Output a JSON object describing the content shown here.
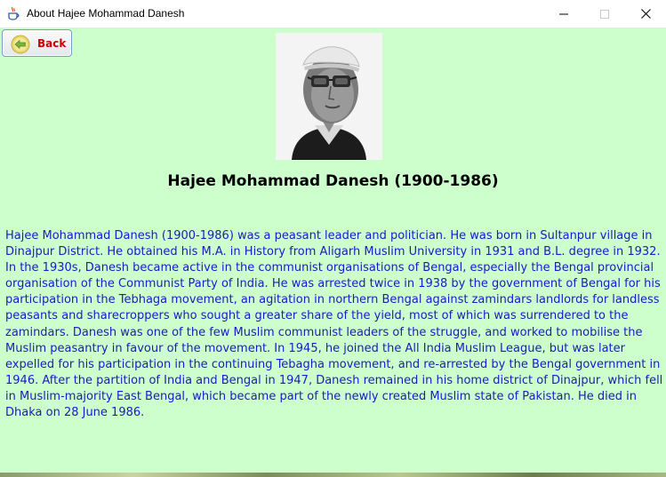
{
  "window": {
    "title": "About Hajee Mohammad Danesh",
    "controls": {
      "minimize_icon": "minimize-icon",
      "maximize_icon": "maximize-icon",
      "close_icon": "close-icon"
    }
  },
  "toolbar": {
    "back_label": "Back",
    "back_icon": "arrow-left-circle-icon",
    "back_label_color": "#cc0000"
  },
  "main": {
    "heading": "Hajee Mohammad Danesh (1900-1986)",
    "biography": "Hajee Mohammad Danesh (1900-1986) was a peasant leader and politician. He was born in Sultanpur village in Dinajpur District. He obtained his M.A. in History from Aligarh Muslim University in 1931 and B.L. degree in 1932. In the 1930s, Danesh became active in the communist organisations of Bengal, especially the Bengal provincial organisation of the Communist Party of India. He was arrested twice in 1938 by the government of Bengal for his participation in the Tebhaga movement, an agitation in northern Bengal against zamindars landlords for landless peasants and sharecroppers who sought a greater share of the yield, most of which was surrendered to the zamindars. Danesh was one of the few Muslim communist leaders of the struggle, and worked to mobilise the Muslim peasantry in favour of the movement. In 1945, he joined the All India Muslim League, but was later expelled for his participation in the continuing Tebagha movement, and re-arrested by the Bengal government in 1946. After the partition of India and Bengal in 1947, Danesh remained in his home district of Dinajpur, which fell in Muslim-majority East Bengal, which became part of the newly created Muslim state of Pakistan. He died in Dhaka on 28 June 1986."
  },
  "colors": {
    "background": "#ccffcc",
    "body_text": "#1a1ac8",
    "heading_text": "#000000"
  }
}
